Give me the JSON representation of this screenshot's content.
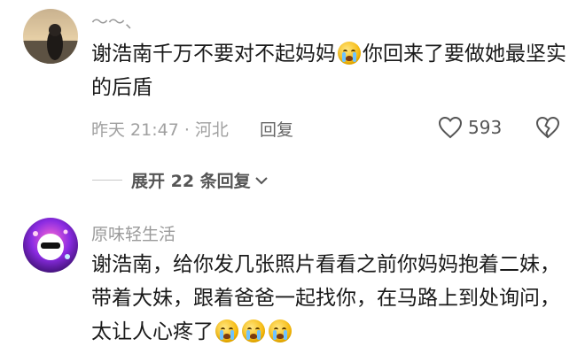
{
  "comments": [
    {
      "username": "～～、",
      "text_part1": "谢浩南千万不要对不起妈妈",
      "text_part2": "你回来了要做她最坚实的后盾",
      "meta": "昨天 21:47 · 河北",
      "reply_label": "回复",
      "like_count": "593"
    },
    {
      "username": "原味轻生活",
      "text": "谢浩南，给你发几张照片看看之前你妈妈抱着二妹，带着大妹，跟着爸爸一起找你，在马路上到处询问，太让人心疼了"
    }
  ],
  "expand_replies_label": "展开 22 条回复",
  "icons": {
    "emoji_crying": "loudly-crying-face-emoji",
    "emoji_pleading": "crying-face-emoji",
    "like": "heart-outline-icon",
    "dislike": "broken-heart-icon",
    "expand": "chevron-down-icon"
  },
  "colors": {
    "text": "#1a1a1a",
    "secondary": "#9a9a9a",
    "background": "#ffffff"
  }
}
